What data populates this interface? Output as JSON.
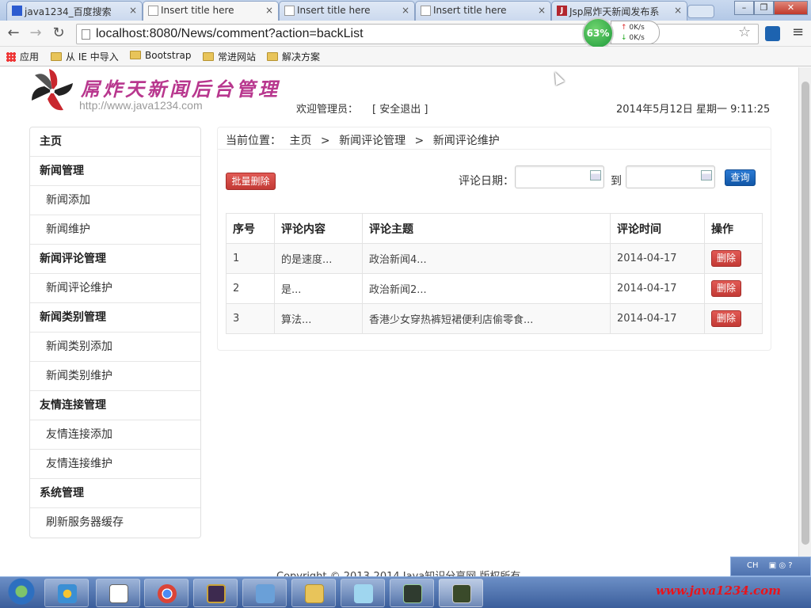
{
  "browser": {
    "tabs": [
      {
        "label": "java1234_百度搜索",
        "icon": "baidu-icon"
      },
      {
        "label": "Insert title here",
        "icon": "page-icon"
      },
      {
        "label": "Insert title here",
        "icon": "page-icon"
      },
      {
        "label": "Insert title here",
        "icon": "page-icon"
      },
      {
        "label": "Jsp屌炸天新闻发布系",
        "icon": "jsp-icon"
      }
    ],
    "tab_close_glyph": "×",
    "url": "localhost:8080/News/comment?action=backList",
    "net_monitor": {
      "percent": "63%",
      "up": "0K/s",
      "down": "0K/s"
    },
    "bookmarks": [
      {
        "label": "应用"
      },
      {
        "label": "从 IE 中导入"
      },
      {
        "label": "Bootstrap"
      },
      {
        "label": "常进网站"
      },
      {
        "label": "解决方案"
      }
    ]
  },
  "header": {
    "logo_title": "屌炸天新闻后台管理",
    "logo_url": "http://www.java1234.com",
    "welcome_label": "欢迎管理员：",
    "logout_label": "[ 安全退出 ]",
    "datetime": "2014年5月12日 星期一 9:11:25"
  },
  "sidebar": {
    "items": [
      {
        "label": "主页",
        "type": "head"
      },
      {
        "label": "新闻管理",
        "type": "head"
      },
      {
        "label": "新闻添加",
        "type": "sub"
      },
      {
        "label": "新闻维护",
        "type": "sub"
      },
      {
        "label": "新闻评论管理",
        "type": "head"
      },
      {
        "label": "新闻评论维护",
        "type": "sub"
      },
      {
        "label": "新闻类别管理",
        "type": "head"
      },
      {
        "label": "新闻类别添加",
        "type": "sub"
      },
      {
        "label": "新闻类别维护",
        "type": "sub"
      },
      {
        "label": "友情连接管理",
        "type": "head"
      },
      {
        "label": "友情连接添加",
        "type": "sub"
      },
      {
        "label": "友情连接维护",
        "type": "sub"
      },
      {
        "label": "系统管理",
        "type": "head"
      },
      {
        "label": "刷新服务器缓存",
        "type": "sub"
      }
    ]
  },
  "breadcrumb": {
    "prefix": "当前位置：",
    "items": [
      "主页",
      "新闻评论管理",
      "新闻评论维护"
    ],
    "separator": ">"
  },
  "toolbar": {
    "batch_delete_label": "批量删除",
    "date_label": "评论日期：",
    "to_label": "到",
    "date_from_value": "",
    "date_to_value": "",
    "query_label": "查询"
  },
  "table": {
    "headers": [
      "序号",
      "评论内容",
      "评论主题",
      "评论时间",
      "操作"
    ],
    "delete_label": "删除",
    "rows": [
      {
        "index": "1",
        "content": "的是速度...",
        "topic": "政治新闻4...",
        "time": "2014-04-17"
      },
      {
        "index": "2",
        "content": "是...",
        "topic": "政治新闻2...",
        "time": "2014-04-17"
      },
      {
        "index": "3",
        "content": "算法...",
        "topic": "香港少女穿热裤短裙便利店偷零食...",
        "time": "2014-04-17"
      }
    ]
  },
  "footer": {
    "text": "Copyright © 2013-2014 Java知识分享网 版权所有"
  },
  "system": {
    "tray_lang": "CH",
    "watermark": "www.java1234.com"
  },
  "colors": {
    "danger": "#c9302c",
    "primary": "#1a63b8",
    "logo_magenta": "#b8378e",
    "watermark_red": "#e8141c"
  }
}
